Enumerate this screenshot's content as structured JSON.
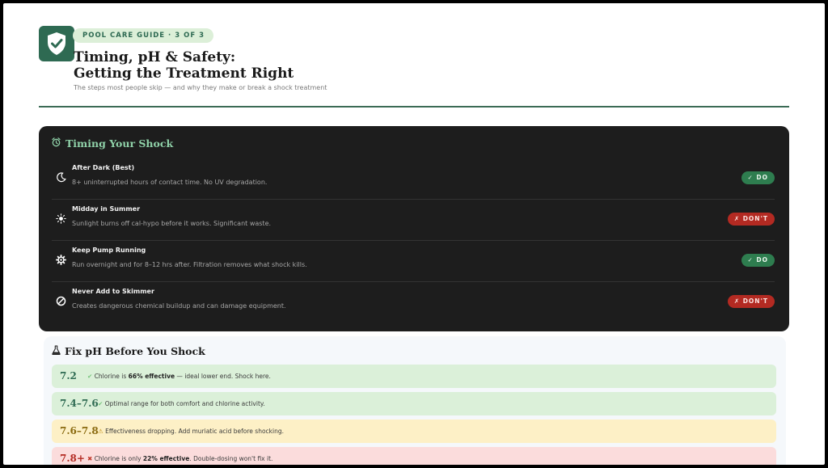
{
  "header": {
    "badge": "POOL CARE GUIDE · 3 OF 3",
    "title_line1": "Timing, pH & Safety:",
    "title_line2": "Getting the Treatment Right",
    "subtitle": "The steps most people skip — and why they make or break a shock treatment",
    "icon": "shield-check-icon"
  },
  "timing": {
    "title": "Timing Your Shock",
    "icon": "alarm-clock-icon",
    "rows": [
      {
        "icon": "moon-icon",
        "label": "After Dark (Best)",
        "desc": "8+ uninterrupted hours of contact time. No UV degradation.",
        "pill": "✓ DO",
        "kind": "do"
      },
      {
        "icon": "sun-icon",
        "label": "Midday in Summer",
        "desc": "Sunlight burns off cal-hypo before it works. Significant waste.",
        "pill": "✗ DON'T",
        "kind": "dont"
      },
      {
        "icon": "gear-icon",
        "label": "Keep Pump Running",
        "desc": "Run overnight and for 8–12 hrs after. Filtration removes what shock kills.",
        "pill": "✓ DO",
        "kind": "do"
      },
      {
        "icon": "prohibited-icon",
        "label": "Never Add to Skimmer",
        "desc": "Creates dangerous chemical buildup and can damage equipment.",
        "pill": "✗ DON'T",
        "kind": "dont"
      }
    ]
  },
  "ph": {
    "title": "Fix pH Before You Shock",
    "icon": "flask-icon",
    "rows": [
      {
        "value": "7.2",
        "mark": "✔",
        "pre": "Chlorine is ",
        "bold": "66% effective",
        "post": " — ideal lower end. Shock here.",
        "tone": "green"
      },
      {
        "value": "7.4–7.6",
        "mark": "✔",
        "pre": "Optimal range for both comfort and chlorine activity.",
        "bold": "",
        "post": "",
        "tone": "green"
      },
      {
        "value": "7.6–7.8",
        "mark": "⚠",
        "pre": "Effectiveness dropping. Add muriatic acid before shocking.",
        "bold": "",
        "post": "",
        "tone": "yellow"
      },
      {
        "value": "7.8+",
        "mark": "✖",
        "pre": "Chlorine is only ",
        "bold": "22% effective",
        "post": ". Double-dosing won't fix it.",
        "tone": "red"
      }
    ]
  },
  "colors": {
    "brand_green": "#2e6a52",
    "do_green": "#2e7d4f",
    "dont_red": "#b32a22",
    "dark_panel": "#1d1d1d"
  }
}
